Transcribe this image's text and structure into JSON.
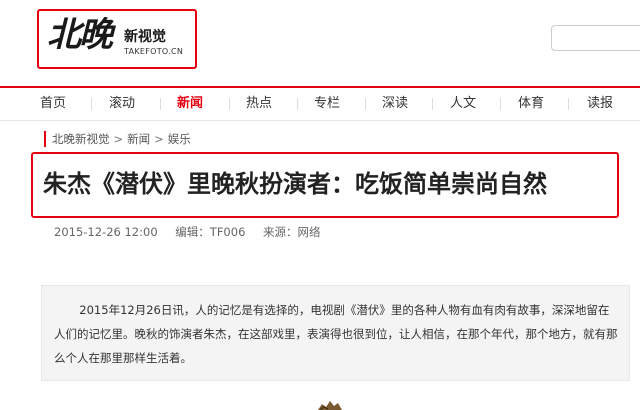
{
  "logo": {
    "main": "北晚",
    "sub": "新视觉",
    "url": "TAKEFOTO.CN"
  },
  "nav": {
    "items": [
      {
        "label": "首页",
        "active": false
      },
      {
        "label": "滚动",
        "active": false
      },
      {
        "label": "新闻",
        "active": true
      },
      {
        "label": "热点",
        "active": false
      },
      {
        "label": "专栏",
        "active": false
      },
      {
        "label": "深读",
        "active": false
      },
      {
        "label": "人文",
        "active": false
      },
      {
        "label": "体育",
        "active": false
      },
      {
        "label": "读报",
        "active": false
      }
    ]
  },
  "breadcrumb": [
    "北晚新视觉",
    "新闻",
    "娱乐"
  ],
  "article": {
    "title": "朱杰《潜伏》里晚秋扮演者：吃饭简单崇尚自然",
    "date": "2015-12-26 12:00",
    "editor": "编辑：TF006",
    "source": "来源：网络",
    "summary": "2015年12月26日讯，人的记忆是有选择的，电视剧《潜伏》里的各种人物有血有肉有故事，深深地留在人们的记忆里。晚秋的饰演者朱杰，在这部戏里，表演得也很到位，让人相信，在那个年代，那个地方，就有那么个人在那里那样生活着。"
  },
  "colors": {
    "accent": "#e60012",
    "summary_bg": "#f4f4f4"
  }
}
